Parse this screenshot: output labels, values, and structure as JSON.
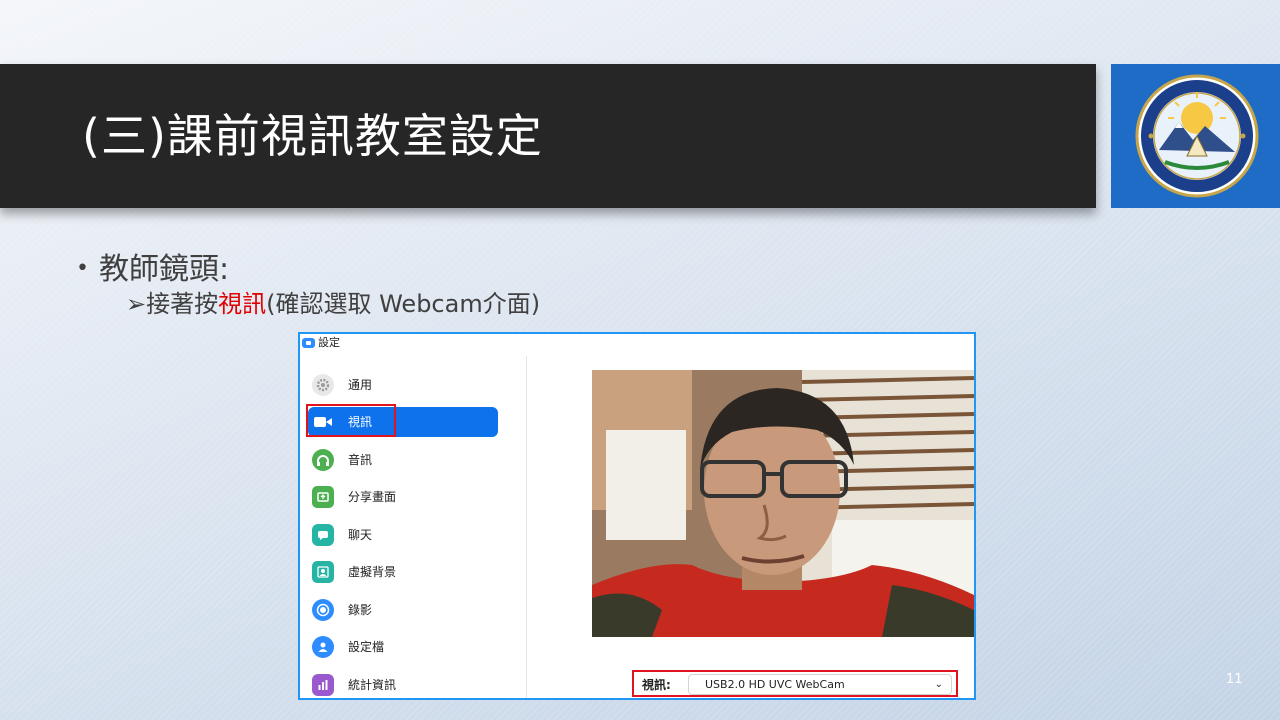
{
  "slide": {
    "title": "(三)課前視訊教室設定",
    "bullet_main": "教師鏡頭:",
    "bullet_sub_prefix": "接著按",
    "bullet_sub_highlight": "視訊",
    "bullet_sub_suffix": "(確認選取 Webcam介面)",
    "page_number": "11",
    "colors": {
      "title_bar": "#262626",
      "logo_bg": "#1f6cc7",
      "highlight_red": "#e00000"
    }
  },
  "settings_window": {
    "title": "設定",
    "nav_items": [
      {
        "label": "通用",
        "icon": "gear-icon",
        "active": false
      },
      {
        "label": "視訊",
        "icon": "video-camera-icon",
        "active": true
      },
      {
        "label": "音訊",
        "icon": "headphones-icon",
        "active": false
      },
      {
        "label": "分享畫面",
        "icon": "share-screen-icon",
        "active": false
      },
      {
        "label": "聊天",
        "icon": "chat-icon",
        "active": false
      },
      {
        "label": "虛擬背景",
        "icon": "virtual-background-icon",
        "active": false
      },
      {
        "label": "錄影",
        "icon": "record-icon",
        "active": false
      },
      {
        "label": "設定檔",
        "icon": "profile-icon",
        "active": false
      },
      {
        "label": "統計資訊",
        "icon": "statistics-icon",
        "active": false
      }
    ],
    "camera_label": "視訊:",
    "camera_selected": "USB2.0 HD UVC WebCam",
    "accent_color": "#0e72ed"
  }
}
